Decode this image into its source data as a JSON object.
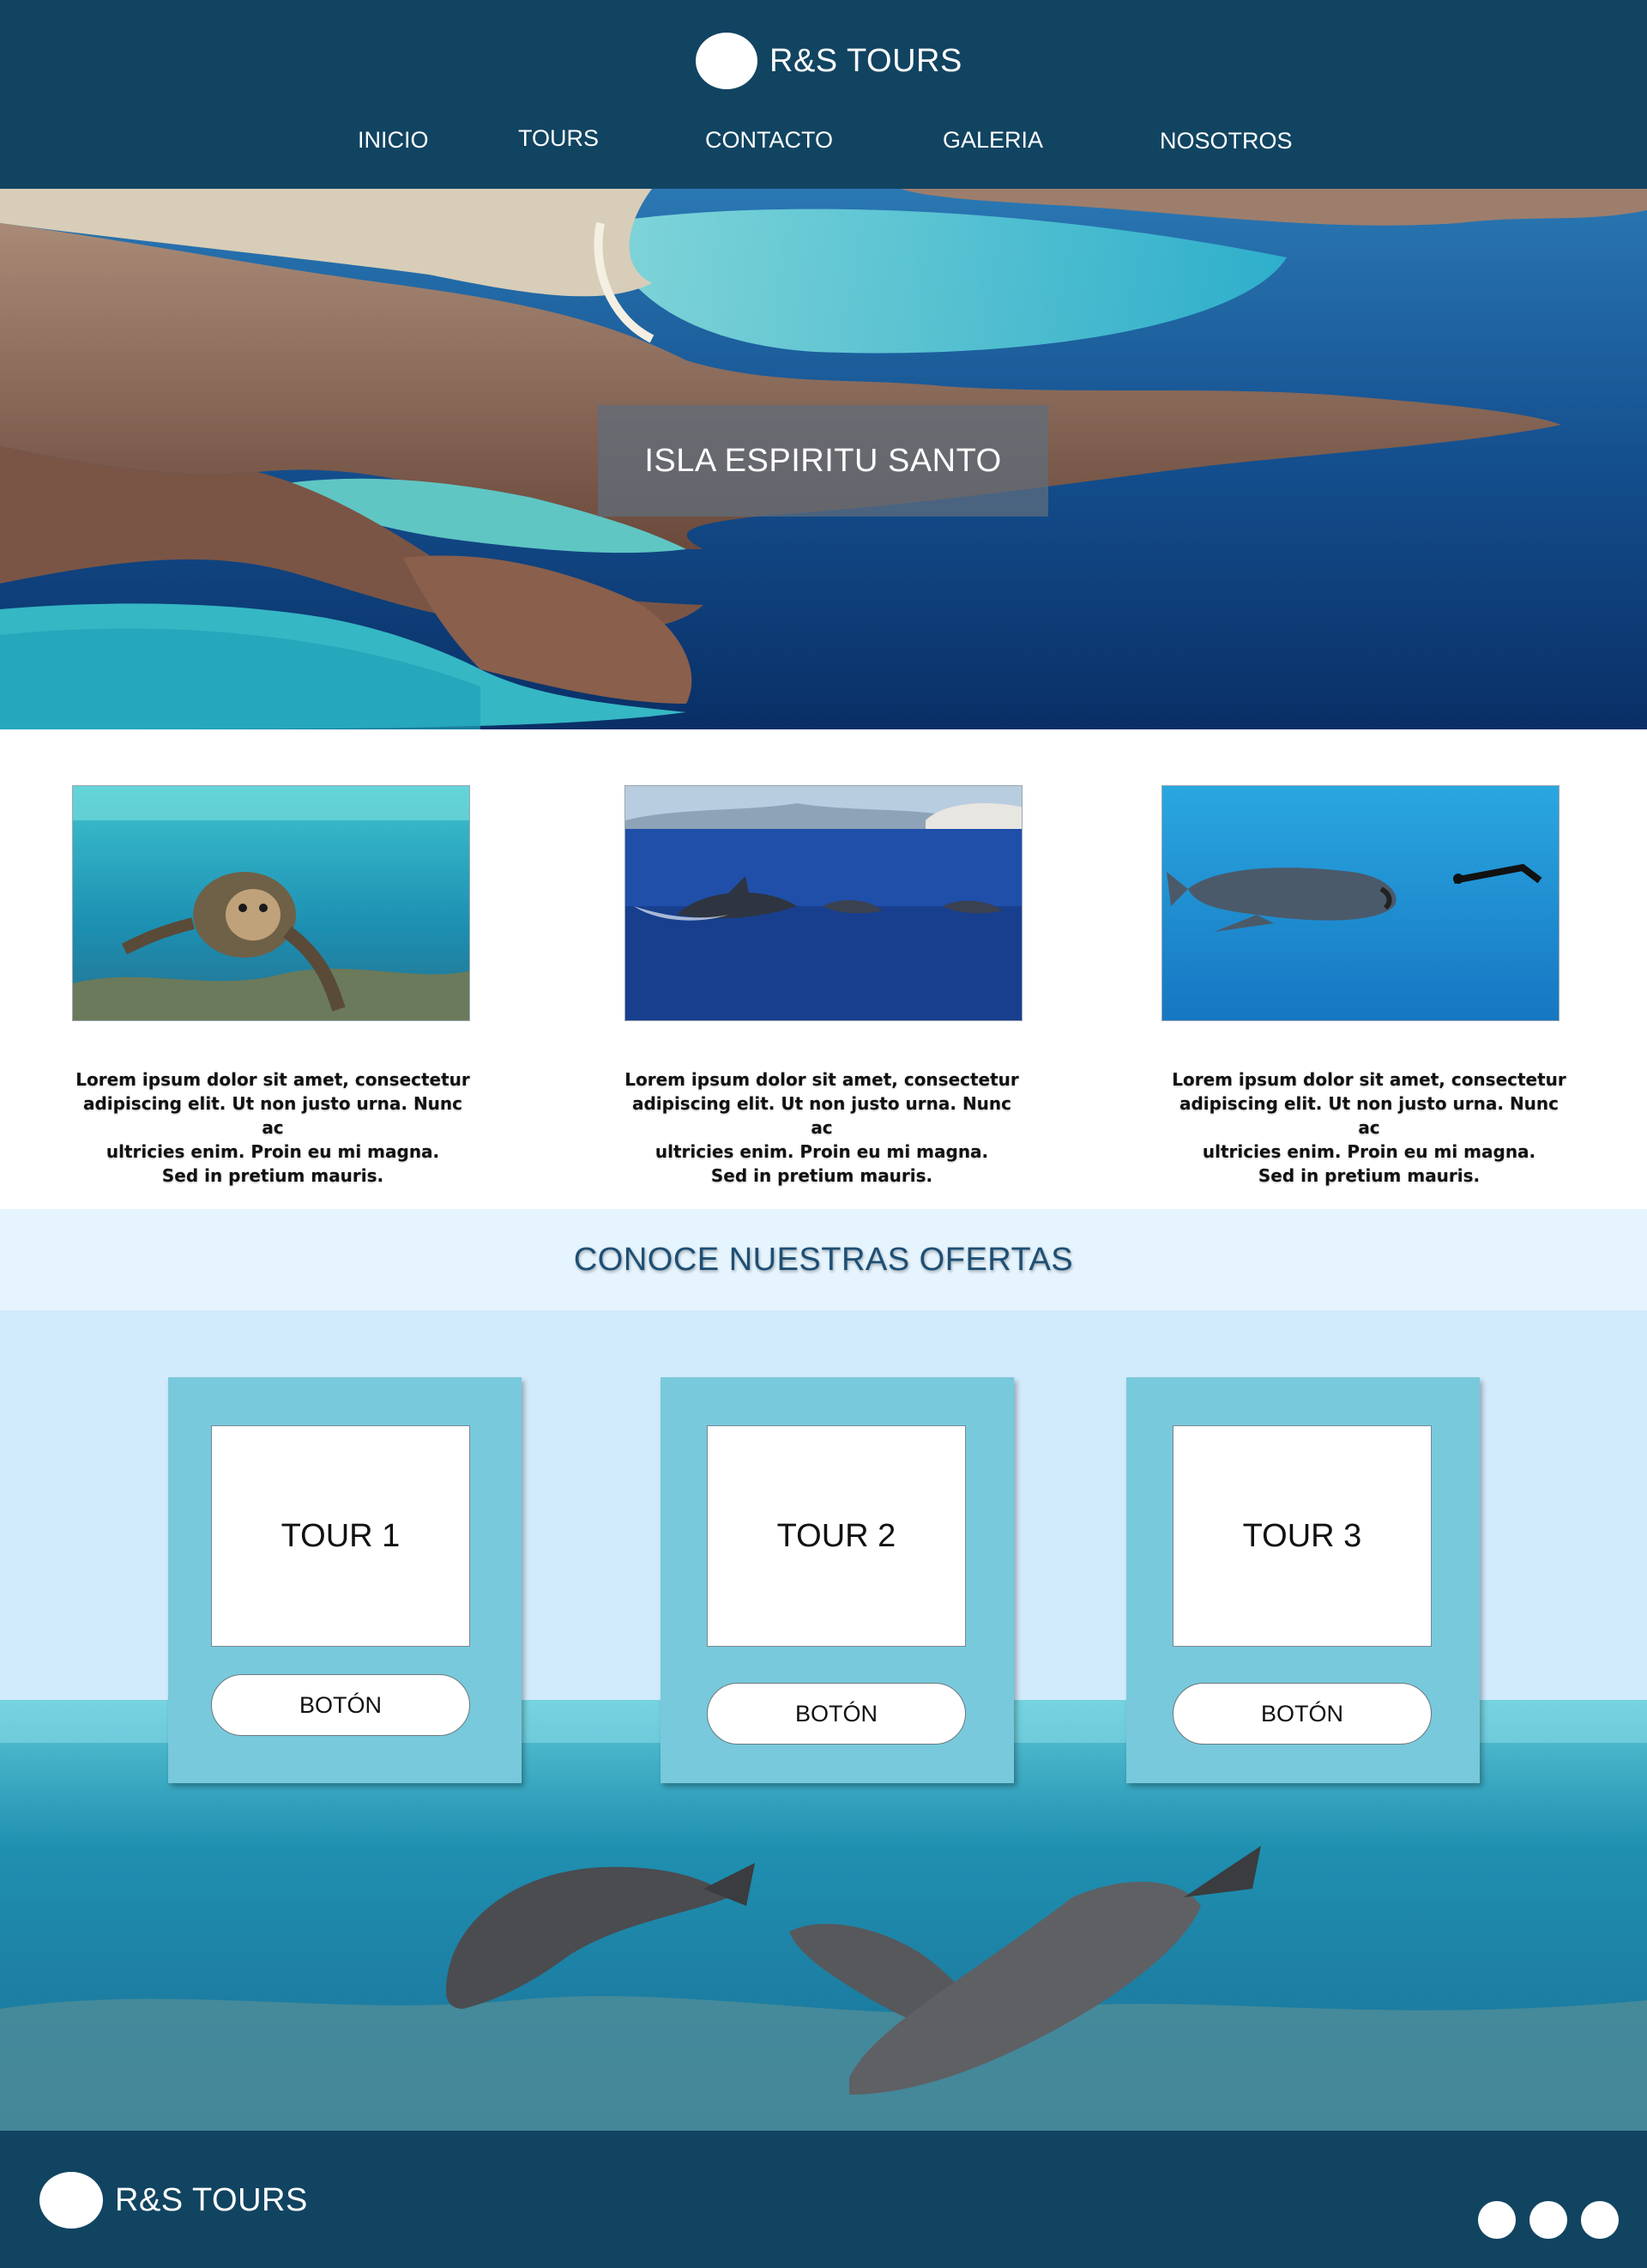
{
  "header": {
    "brand": "R&S TOURS",
    "nav": [
      "INICIO",
      "TOURS",
      "CONTACTO",
      "GALERIA",
      "NOSOTROS"
    ]
  },
  "hero": {
    "caption": "ISLA ESPIRITU SANTO"
  },
  "features": [
    {
      "image": "sea-lion-photo",
      "lines": [
        "Lorem ipsum dolor sit amet, consectetur",
        "adipiscing elit. Ut non justo urna. Nunc ac",
        "ultricies enim. Proin eu mi magna.",
        "Sed in pretium mauris."
      ]
    },
    {
      "image": "dolphins-photo",
      "lines": [
        "Lorem ipsum dolor sit amet, consectetur",
        "adipiscing elit. Ut non justo urna. Nunc ac",
        "ultricies enim. Proin eu mi magna.",
        "Sed in pretium mauris."
      ]
    },
    {
      "image": "whale-shark-photo",
      "lines": [
        "Lorem ipsum dolor sit amet, consectetur",
        "adipiscing elit. Ut non justo urna. Nunc ac",
        "ultricies enim. Proin eu mi magna.",
        "Sed in pretium mauris."
      ]
    }
  ],
  "offers": {
    "title": "CONOCE NUESTRAS OFERTAS",
    "tours": [
      {
        "label": "TOUR 1",
        "button": "BOTÓN"
      },
      {
        "label": "TOUR 2",
        "button": "BOTÓN"
      },
      {
        "label": "TOUR 3",
        "button": "BOTÓN"
      }
    ]
  },
  "footer": {
    "brand": "R&S TOURS",
    "social_icons": [
      "social-icon-1",
      "social-icon-2",
      "social-icon-3"
    ]
  },
  "colors": {
    "header_bg": "#114461",
    "offers_band_bg": "#e6f4fd",
    "offers_section_bg": "#d2ebfc",
    "card_bg": "#78c9dc",
    "title_color": "#1d4f75"
  }
}
